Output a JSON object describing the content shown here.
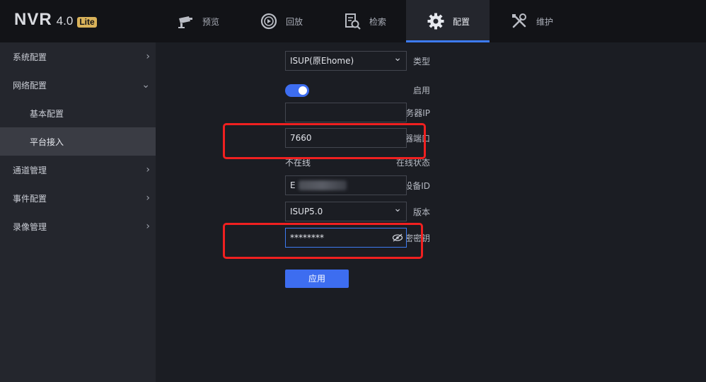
{
  "app": {
    "name": "NVR",
    "version": "4.0",
    "edition": "Lite"
  },
  "nav": [
    {
      "label": "预览",
      "icon": "camera-icon"
    },
    {
      "label": "回放",
      "icon": "playback-icon"
    },
    {
      "label": "检索",
      "icon": "search-file-icon"
    },
    {
      "label": "配置",
      "icon": "gear-icon",
      "active": true
    },
    {
      "label": "维护",
      "icon": "tools-icon"
    }
  ],
  "sidebar": {
    "items": [
      {
        "label": "系统配置",
        "chevron": "›"
      },
      {
        "label": "网络配置",
        "chevron": "⌄"
      },
      {
        "label": "基本配置"
      },
      {
        "label": "平台接入",
        "selected": true
      },
      {
        "label": "通道管理",
        "chevron": "›"
      },
      {
        "label": "事件配置",
        "chevron": "›"
      },
      {
        "label": "录像管理",
        "chevron": "›"
      }
    ]
  },
  "form": {
    "type": {
      "label": "类型",
      "value": "ISUP(原Ehome)"
    },
    "enable": {
      "label": "启用",
      "on": true
    },
    "server_ip": {
      "label": "服务器IP",
      "value": ""
    },
    "server_port": {
      "label": "服务器端口",
      "value": "7660"
    },
    "status": {
      "label": "在线状态",
      "value": "不在线"
    },
    "device_id": {
      "label": "设备ID",
      "value": "E"
    },
    "version": {
      "label": "版本",
      "value": "ISUP5.0"
    },
    "key": {
      "label": "加密密钥",
      "value": "********"
    },
    "apply_label": "应用"
  },
  "colors": {
    "accent": "#3d6df0",
    "highlight": "#f02020"
  }
}
